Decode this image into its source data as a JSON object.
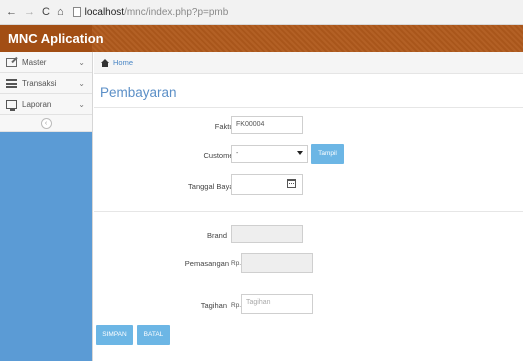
{
  "browser": {
    "url_host": "localhost",
    "url_path": "/mnc/index.php?p=pmb"
  },
  "app": {
    "title": "MNC Aplication"
  },
  "sidebar": {
    "items": [
      {
        "label": "Master",
        "icon": "edit-icon"
      },
      {
        "label": "Transaksi",
        "icon": "list-icon"
      },
      {
        "label": "Laporan",
        "icon": "monitor-icon"
      }
    ]
  },
  "breadcrumb": {
    "home": "Home"
  },
  "page": {
    "title": "Pembayaran"
  },
  "form": {
    "faktur": {
      "label": "Faktur",
      "value": "FK00004"
    },
    "customer": {
      "label": "Customer",
      "value": "-"
    },
    "tampil_label": "Tampil",
    "tanggal_bayar": {
      "label": "Tanggal Bayar",
      "value": ""
    },
    "brand": {
      "label": "Brand",
      "value": ""
    },
    "pemasangan": {
      "label": "Pemasangan",
      "prefix": "Rp.",
      "value": ""
    },
    "tagihan": {
      "label": "Tagihan",
      "prefix": "Rp.",
      "placeholder": "Tagihan"
    },
    "simpan_label": "SIMPAN",
    "batal_label": "BATAL"
  },
  "colors": {
    "header": "#b05a1c",
    "sidebar": "#5b9bd5",
    "accent": "#6cb6e5",
    "title": "#5b8fc7"
  }
}
